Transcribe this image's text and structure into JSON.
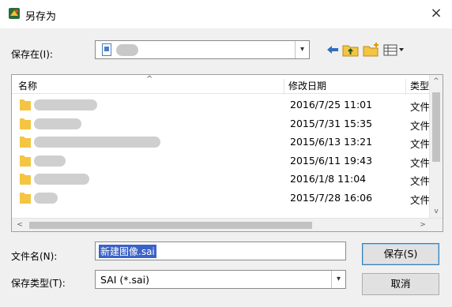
{
  "window": {
    "title": "另存为",
    "close": "×"
  },
  "location": {
    "label": "保存在(I):",
    "drop": "▾"
  },
  "list": {
    "columns": {
      "name": "名称",
      "sort": "^",
      "date": "修改日期",
      "type": "类型"
    },
    "rows": [
      {
        "date": "2016/7/25 11:01",
        "type": "文件"
      },
      {
        "date": "2015/7/31 15:35",
        "type": "文件"
      },
      {
        "date": "2015/6/13 13:21",
        "type": "文件"
      },
      {
        "date": "2015/6/11 19:43",
        "type": "文件"
      },
      {
        "date": "2016/1/8 11:04",
        "type": "文件"
      },
      {
        "date": "2015/7/28 16:06",
        "type": "文件"
      }
    ],
    "vscroll": {
      "up": "^",
      "down": "v"
    },
    "hscroll": {
      "left": "<",
      "right": ">"
    }
  },
  "filename": {
    "label": "文件名(N):",
    "value": "新建图像.sai"
  },
  "filetype": {
    "label": "保存类型(T):",
    "value": "SAI (*.sai)",
    "drop": "▾"
  },
  "buttons": {
    "save": "保存(S)",
    "cancel": "取消"
  },
  "icons": {
    "app": "app-icon",
    "back": "back-arrow-icon",
    "up_folder": "up-folder-icon",
    "new_folder": "new-folder-icon",
    "view_menu": "view-menu-icon",
    "folder": "folder-icon"
  },
  "colors": {
    "selection": "#3a62c9",
    "folder": "#f4c542",
    "accent_border": "#3c7fb1"
  }
}
